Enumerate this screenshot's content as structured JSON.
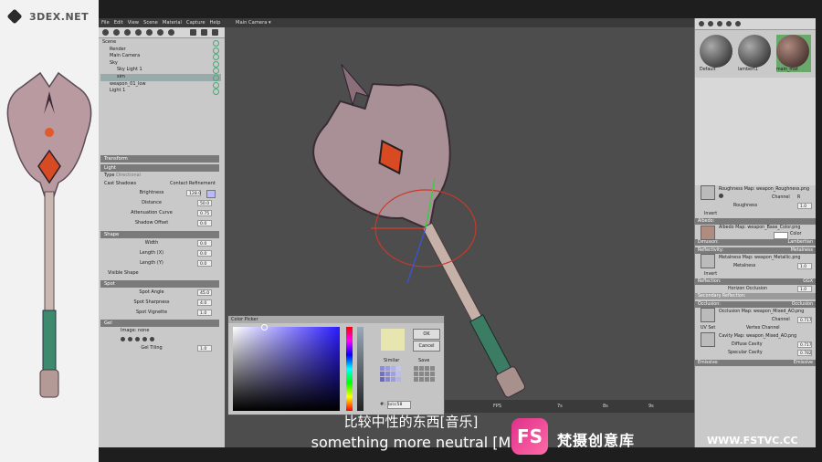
{
  "logo": {
    "text": "3DEX.NET"
  },
  "menu": [
    "File",
    "Edit",
    "View",
    "Scene",
    "Material",
    "Capture",
    "Help"
  ],
  "viewport": {
    "camera_label": "Main Camera ▾"
  },
  "scene_tree": [
    {
      "label": "Scene",
      "selected": false
    },
    {
      "label": "Render",
      "selected": false
    },
    {
      "label": "Main Camera",
      "selected": false
    },
    {
      "label": "Sky",
      "selected": false
    },
    {
      "label": "Sky Light 1",
      "selected": false
    },
    {
      "label": "sim",
      "selected": true
    },
    {
      "label": "weapon_01_low",
      "selected": false
    },
    {
      "label": "Light 1",
      "selected": false
    }
  ],
  "props": {
    "transform": "Transform",
    "light": "Light",
    "type_label": "Type",
    "type_value": "Directional",
    "cast_shadows": "Cast Shadows",
    "contact_refinement": "Contact Refinement",
    "brightness": {
      "label": "Brightness",
      "value": "128.0"
    },
    "distance": {
      "label": "Distance",
      "value": "50.0"
    },
    "attenuation": {
      "label": "Attenuation Curve",
      "value": "0.75"
    },
    "shadow_offset": {
      "label": "Shadow Offset",
      "value": "0.0"
    },
    "shape": "Shape",
    "width": {
      "label": "Width",
      "value": "0.0"
    },
    "length_x": {
      "label": "Length (X)",
      "value": "0.0"
    },
    "length_y": {
      "label": "Length (Y)",
      "value": "0.0"
    },
    "visible_shape": "Visible Shape",
    "spot": "Spot",
    "spot_angle": {
      "label": "Spot Angle",
      "value": "45.0"
    },
    "spot_sharpness": {
      "label": "Spot Sharpness",
      "value": "4.0"
    },
    "spot_vignette": {
      "label": "Spot Vignette",
      "value": "1.0"
    },
    "gel": "Gel",
    "image": "Image: none",
    "gel_tiling": {
      "label": "Gel Tiling",
      "value": "1.0"
    }
  },
  "materials": [
    {
      "name": "Default",
      "color": "#3a3a3a"
    },
    {
      "name": "lambert1",
      "color": "#3a3a3a"
    },
    {
      "name": "main_mat",
      "color": "#5a3b33"
    }
  ],
  "mat_panel": {
    "roughness_map": "Roughness Map: weapon_Roughness.png",
    "channel": "Channel",
    "channel_val": "R",
    "roughness": {
      "label": "Roughness",
      "value": "1.0"
    },
    "invert": "Invert",
    "albedo_sec": "Albedo:",
    "albedo_map": "Albedo Map: weapon_Base_Color.png",
    "color": "Color",
    "diffusion_sec": "Diffusion:",
    "diffusion_val": "Lambertian",
    "reflectivity_sec": "Reflectivity:",
    "reflectivity_val": "Metalness",
    "metalness_map": "Metalness Map: weapon_Metallic.png",
    "metalness": {
      "label": "Metalness",
      "value": "1.0"
    },
    "reflection_sec": "Reflection:",
    "reflection_val": "GGX",
    "horizon_occ": {
      "label": "Horizon Occlusion",
      "value": "1.0"
    },
    "secondary_reflection": "Secondary Reflection:",
    "occlusion_sec": "Occlusion:",
    "occlusion_val": "Occlusion",
    "occlusion_map": "Occlusion Map: weapon_Mixed_AO.png",
    "occ_value": "0.717",
    "uv_set": "UV Set",
    "vertex_channel": "Vertex Channel",
    "cavity_map": "Cavity Map: weapon_Mixed_AO.png",
    "diffuse_cavity": {
      "label": "Diffuse Cavity",
      "value": "0.717"
    },
    "specular_cavity": {
      "label": "Specular Cavity",
      "value": "0.782"
    },
    "emissive_sec": "Emissive:",
    "emissive_val": "Emissive"
  },
  "color_picker": {
    "title": "Color Picker",
    "ok": "OK",
    "cancel": "Cancel",
    "similar": "Similar",
    "save": "Save",
    "hex_label": "#:",
    "hex_value": "b/cc58",
    "swatch_color": "#e8e6b0"
  },
  "timeline": {
    "fps": "FPS",
    "ticks": [
      "7s",
      "8s",
      "9s"
    ]
  },
  "subtitles": {
    "cn": "比较中性的东西[音乐]",
    "en": "something more neutral [M"
  },
  "watermark": {
    "logo": "FS",
    "brand": "梵摄创意库",
    "site": "WWW.FSTVC.CC"
  }
}
